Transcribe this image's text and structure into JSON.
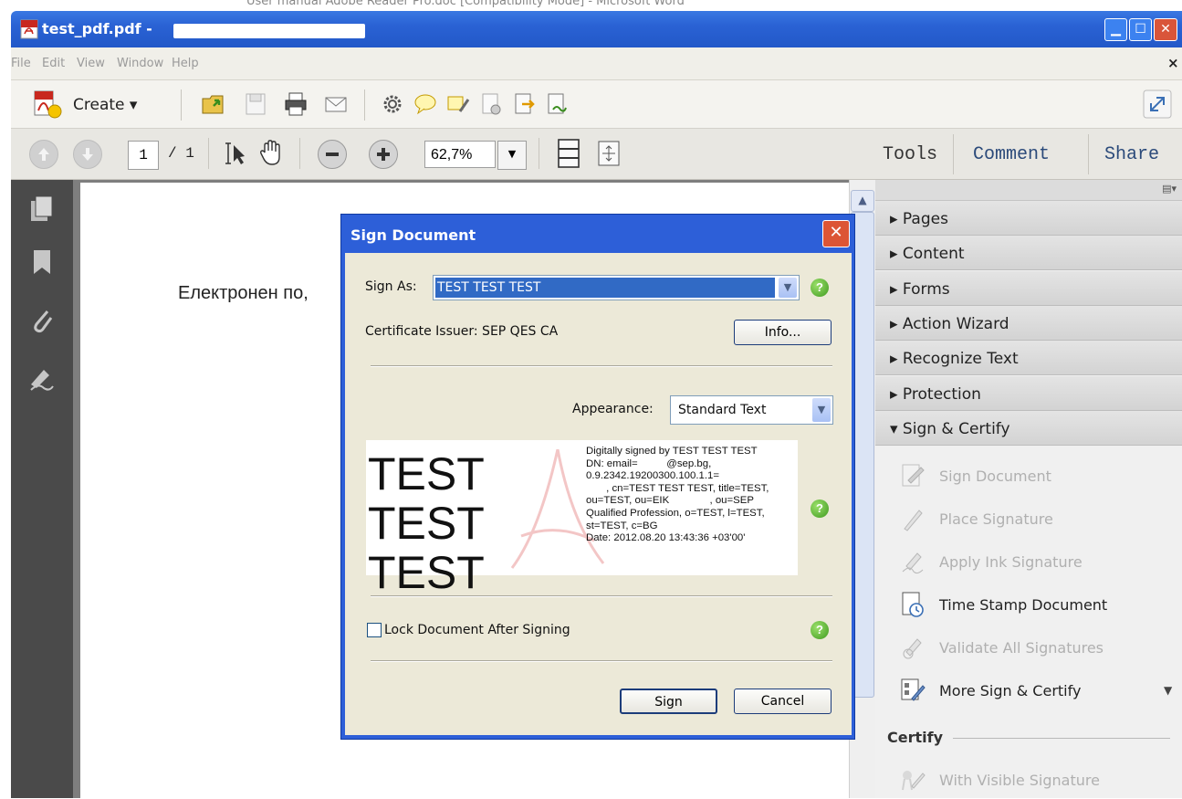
{
  "window": {
    "title": "test_pdf.pdf -",
    "background_title": "User manual Adobe Reader Pro.doc [Compatibility Mode] - Microsoft Word",
    "controls": [
      "minimize",
      "maximize",
      "close"
    ]
  },
  "menu": {
    "items": [
      "File",
      "Edit",
      "View",
      "Window",
      "Help"
    ],
    "close_label": "×"
  },
  "toolbar": {
    "create_label": "Create ▾",
    "icons": [
      "open-icon",
      "save-icon",
      "print-icon",
      "email-icon",
      "settings-icon",
      "comment-icon",
      "highlight-icon",
      "redact-icon",
      "export-icon",
      "sign-icon"
    ]
  },
  "nav": {
    "page_current": "1",
    "page_total": "/ 1",
    "zoom": "62,7%",
    "right_tabs": [
      "Tools",
      "Comment",
      "Share"
    ]
  },
  "document": {
    "visible_text": "Електронен по,"
  },
  "tools_panel": {
    "sections": [
      {
        "label": "▸ Pages"
      },
      {
        "label": "▸ Content"
      },
      {
        "label": "▸ Forms"
      },
      {
        "label": "▸ Action Wizard"
      },
      {
        "label": "▸ Recognize Text"
      },
      {
        "label": "▸ Protection"
      },
      {
        "label": "▾ Sign & Certify"
      }
    ],
    "sign_items": [
      {
        "label": "Sign Document",
        "enabled": false
      },
      {
        "label": "Place Signature",
        "enabled": false
      },
      {
        "label": "Apply Ink Signature",
        "enabled": false
      },
      {
        "label": "Time Stamp Document",
        "enabled": true
      },
      {
        "label": "Validate All Signatures",
        "enabled": false
      },
      {
        "label": "More Sign & Certify",
        "enabled": true
      }
    ],
    "certify_header": "Certify",
    "certify_items": [
      {
        "label": "With Visible Signature",
        "enabled": false
      }
    ]
  },
  "dialog": {
    "title": "Sign Document",
    "sign_as_label": "Sign As:",
    "sign_as_value": "TEST TEST TEST",
    "issuer_text": "Certificate Issuer: SEP QES CA",
    "info_button": "Info...",
    "appearance_label": "Appearance:",
    "appearance_value": "Standard Text",
    "preview_name": "TEST TEST TEST",
    "preview_details": "Digitally signed by TEST TEST TEST\nDN: email=          @sep.bg,\n0.9.2342.19200300.100.1.1=\n       , cn=TEST TEST TEST, title=TEST,\nou=TEST, ou=EIK              , ou=SEP\nQualified Profession, o=TEST, l=TEST,\nst=TEST, c=BG\nDate: 2012.08.20 13:43:36 +03'00'",
    "lock_label": "Lock Document After Signing",
    "lock_checked": false,
    "sign_button": "Sign",
    "cancel_button": "Cancel",
    "help_glyph": "?"
  }
}
